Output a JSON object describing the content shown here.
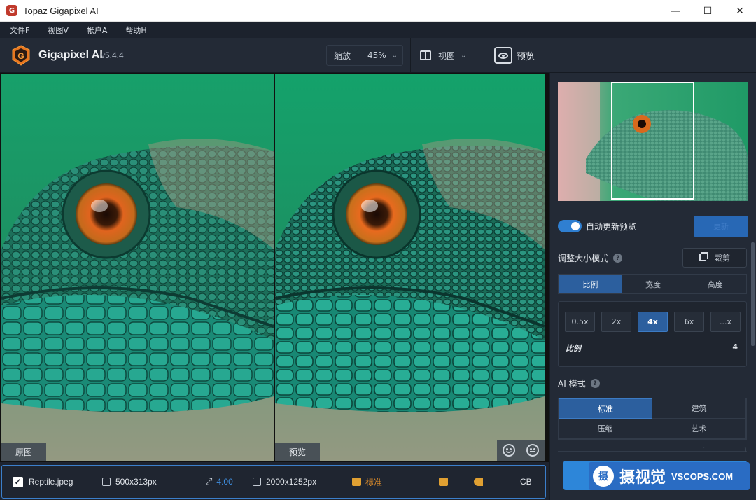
{
  "window": {
    "title": "Topaz Gigapixel AI",
    "controls": {
      "minimize": "—",
      "maximize": "☐",
      "close": "✕"
    }
  },
  "menu": [
    {
      "label": "文件F"
    },
    {
      "label": "视图V"
    },
    {
      "label": "帐户A"
    },
    {
      "label": "帮助H"
    }
  ],
  "toolbar": {
    "brand": "Gigapixel AI",
    "version": "v5.4.4",
    "zoom_label": "缩放",
    "zoom_value": "45%",
    "view_label": "视图",
    "preview_label": "预览"
  },
  "panes": {
    "left_label": "原图",
    "right_label": "预览"
  },
  "panel": {
    "auto_update_label": "自动更新预览",
    "auto_update_on": true,
    "update_button": "更新",
    "resize_mode_title": "调整大小模式",
    "help_glyph": "?",
    "crop_button": "裁剪",
    "resize_tabs": [
      {
        "label": "比例",
        "active": true
      },
      {
        "label": "宽度",
        "active": false
      },
      {
        "label": "高度",
        "active": false
      }
    ],
    "scale_options": [
      {
        "label": "0.5x",
        "active": false
      },
      {
        "label": "2x",
        "active": false
      },
      {
        "label": "4x",
        "active": true
      },
      {
        "label": "6x",
        "active": false
      },
      {
        "label": "...x",
        "active": false
      }
    ],
    "scale_label": "比例",
    "scale_value": "4",
    "ai_mode_title": "AI 模式",
    "ai_modes": [
      {
        "label": "标准",
        "active": true
      },
      {
        "label": "建筑",
        "active": false
      },
      {
        "label": "压缩",
        "active": false
      },
      {
        "label": "艺术",
        "active": false
      }
    ]
  },
  "watermark": {
    "logo_glyph": "摄",
    "text": "摄视觉",
    "url": "VSCOPS.COM"
  },
  "filebar": {
    "checked": true,
    "filename": "Reptile.jpeg",
    "input_size": "500x313px",
    "scale": "4.00",
    "output_size": "2000x1252px",
    "mode": "标准",
    "extra": "CB"
  },
  "colors": {
    "accent": "#2c5f9e",
    "accent_bright": "#2d86d9",
    "background": "#232a36",
    "orange": "#d98a2b"
  }
}
